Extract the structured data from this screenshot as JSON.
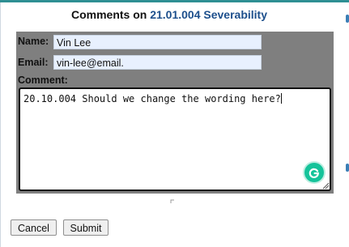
{
  "dialog": {
    "title_prefix": "Comments on ",
    "title_link": "21.01.004 Severability"
  },
  "form": {
    "name_label": "Name:",
    "name_value": "Vin Lee",
    "email_label": "Email:",
    "email_value": "vin-lee@email.",
    "comment_label": "Comment:",
    "comment_text": "20.10.004 Should we change the wording here?"
  },
  "buttons": {
    "cancel_label": "Cancel",
    "submit_label": "Submit"
  },
  "icons": {
    "grammarly": "grammarly-icon",
    "resize": "resize-grip-icon",
    "drag": "drag-handle-icon"
  },
  "colors": {
    "accent_bar": "#2f8f93",
    "link": "#1d4f8c",
    "panel": "#7f7f7f",
    "grammarly": "#15c39a"
  }
}
